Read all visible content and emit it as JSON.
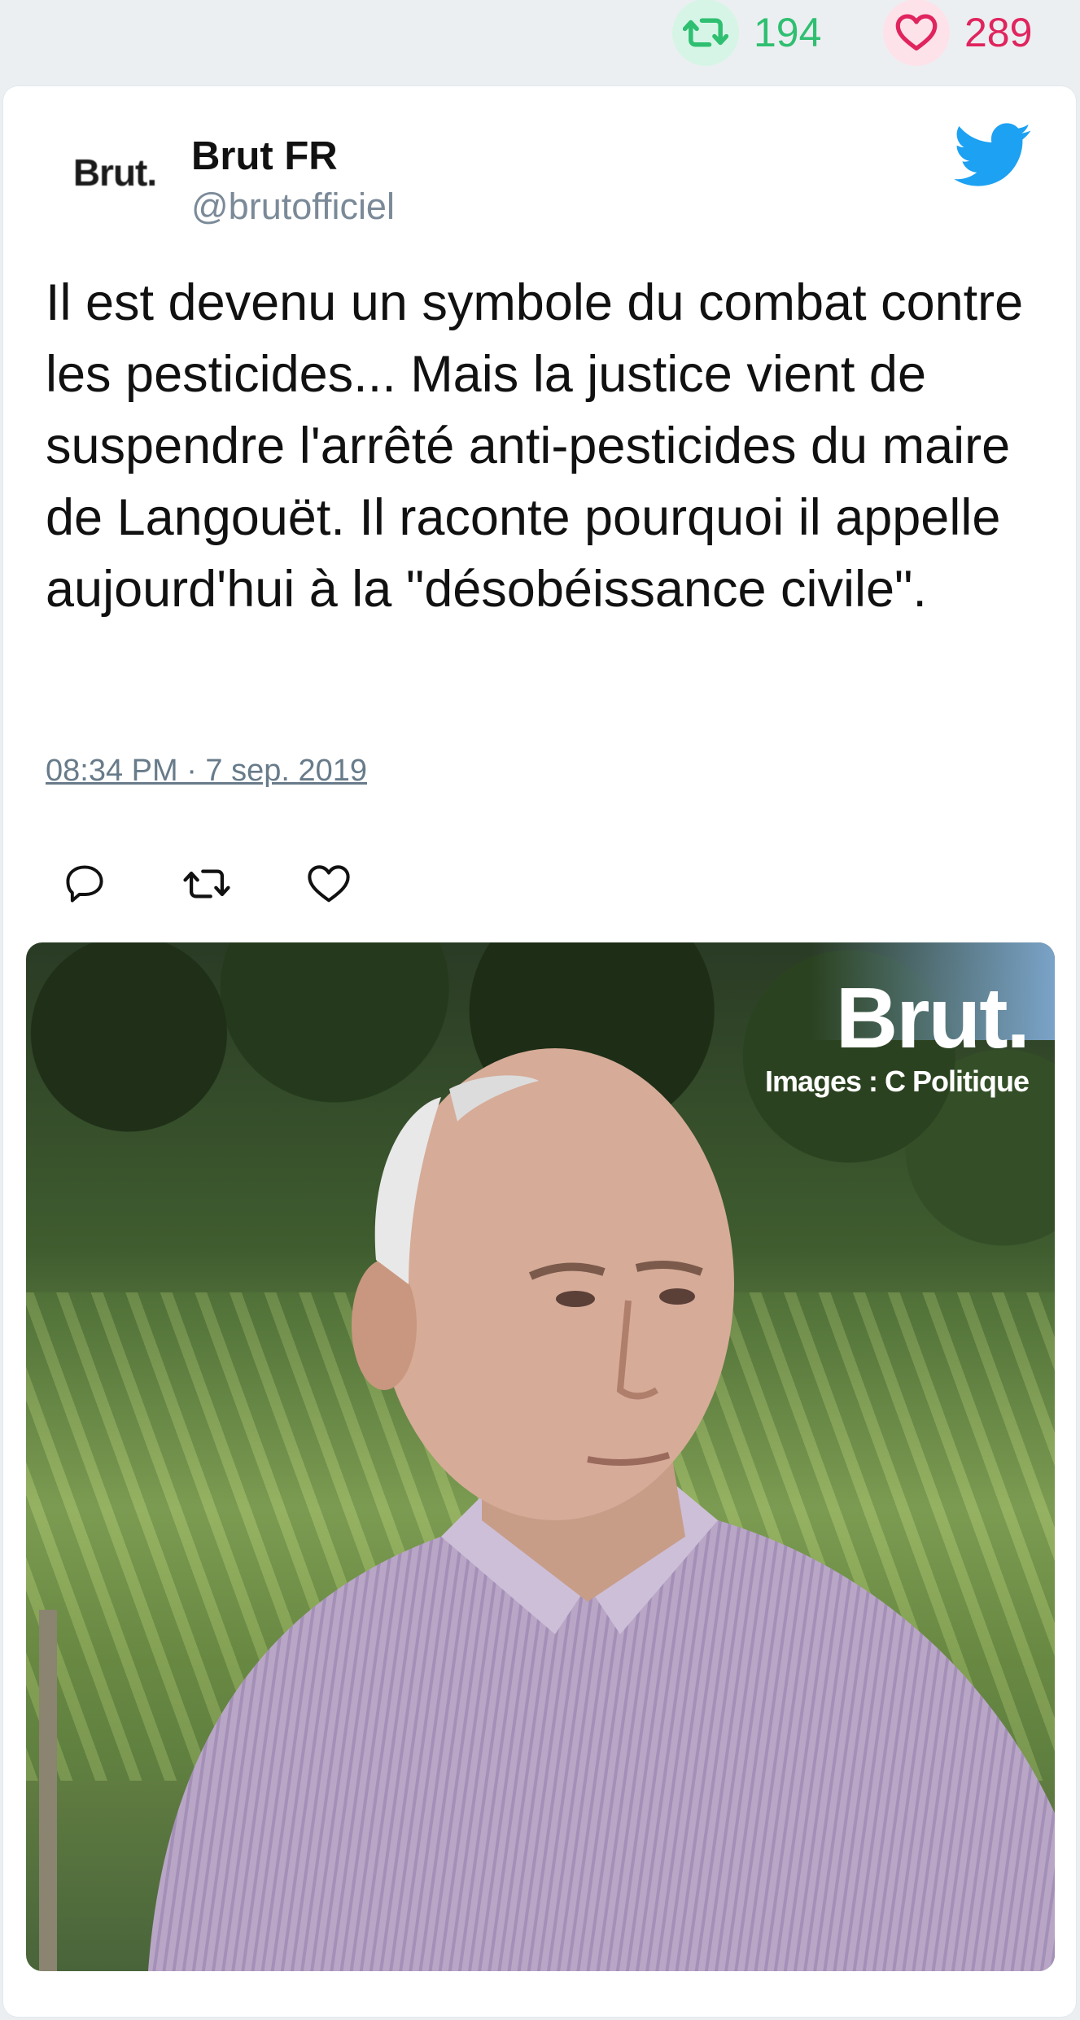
{
  "stats": {
    "retweet_count": "194",
    "like_count": "289",
    "retweet_icon": "retweet-icon",
    "like_icon": "heart-icon",
    "retweet_color": "#2fbf71",
    "like_color": "#e0245e"
  },
  "tweet": {
    "avatar_text": "Brut.",
    "author_name": "Brut FR",
    "author_handle": "@brutofficiel",
    "platform_icon": "twitter-bird-icon",
    "brand_color": "#1da1f2",
    "text": "Il est devenu un symbole du combat contre les pesticides... Mais la justice vient de suspendre l'arrêté anti-pesticides du maire de Langouët. Il raconte pourquoi il appelle aujourd'hui à la \"désobéissance civile\".",
    "timestamp": "08:34 PM · 7 sep. 2019",
    "actions": [
      "reply-icon",
      "retweet-icon",
      "like-icon"
    ]
  },
  "media": {
    "watermark_title": "Brut.",
    "watermark_credit": "Images : C Politique"
  }
}
